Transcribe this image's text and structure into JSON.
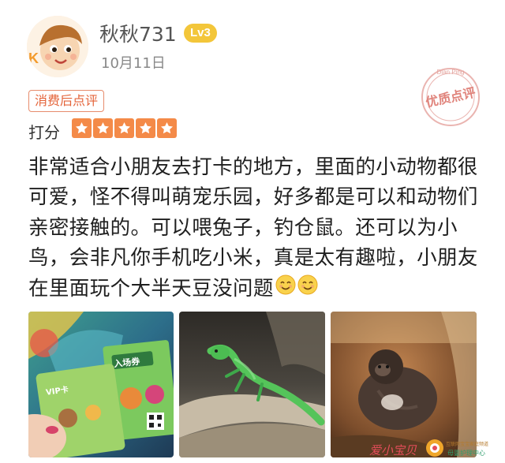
{
  "user": {
    "name": "秋秋731",
    "level": "Lv3",
    "date": "10月11日"
  },
  "stamp": {
    "text": "优质点评",
    "arc": "Dian Ping",
    "icon": "quality-review-stamp-icon"
  },
  "tag": "消费后点评",
  "rating": {
    "label": "打分",
    "stars": 5,
    "max_stars": 5
  },
  "review": {
    "text": "非常适合小朋友去打卡的地方，里面的小动物都很可爱，怪不得叫萌宠乐园，好多都是可以和动物们亲密接触的。可以喂兔子，钓仓鼠。还可以为小鸟，会非凡你手机吃小米，真是太有趣啦，小朋友在里面玩个大半天豆没问题",
    "emojis": [
      "smiling-face-icon",
      "smiling-face-icon"
    ]
  },
  "photos": [
    {
      "ticket_title": "入场券",
      "card_label": "VIP卡",
      "icon": "ticket-photo"
    },
    {
      "icon": "lizard-photo"
    },
    {
      "icon": "monkey-photo"
    }
  ],
  "watermark": {
    "text": "爱小宝贝",
    "sub_top": "互联网宝宝家庭频道",
    "sub_bottom": "母婴护理中心"
  },
  "colors": {
    "accent": "#f48a48",
    "tag": "#e4643a",
    "level": "#f3c63a"
  }
}
